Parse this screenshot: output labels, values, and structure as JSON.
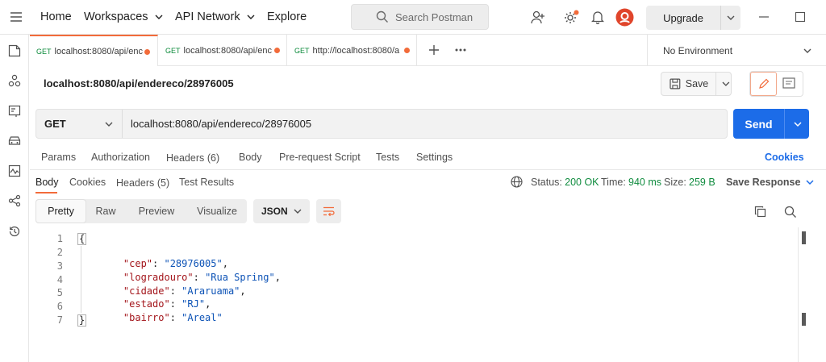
{
  "topbar": {
    "home": "Home",
    "workspaces": "Workspaces",
    "api_network": "API Network",
    "explore": "Explore",
    "search_placeholder": "Search Postman",
    "upgrade": "Upgrade"
  },
  "tabs": [
    {
      "method": "GET",
      "label": "localhost:8080/api/enc"
    },
    {
      "method": "GET",
      "label": "localhost:8080/api/enc"
    },
    {
      "method": "GET",
      "label": "http://localhost:8080/a"
    }
  ],
  "environment": "No Environment",
  "request": {
    "title": "localhost:8080/api/endereco/28976005",
    "save_label": "Save",
    "method": "GET",
    "url": "localhost:8080/api/endereco/28976005",
    "send_label": "Send"
  },
  "request_tabs": {
    "params": "Params",
    "authorization": "Authorization",
    "headers": "Headers",
    "headers_count": "(6)",
    "body": "Body",
    "prerequest": "Pre-request Script",
    "tests": "Tests",
    "settings": "Settings",
    "cookies": "Cookies"
  },
  "response_tabs": {
    "body": "Body",
    "cookies": "Cookies",
    "headers": "Headers",
    "headers_count": "(5)",
    "test_results": "Test Results"
  },
  "response_meta": {
    "status_label": "Status:",
    "status_value": "200 OK",
    "time_label": "Time:",
    "time_value": "940 ms",
    "size_label": "Size:",
    "size_value": "259 B",
    "save_response": "Save Response"
  },
  "view_modes": {
    "pretty": "Pretty",
    "raw": "Raw",
    "preview": "Preview",
    "visualize": "Visualize",
    "format": "JSON"
  },
  "response_body": {
    "line_numbers": [
      "1",
      "2",
      "3",
      "4",
      "5",
      "6",
      "7"
    ],
    "open_brace": "{",
    "close_brace": "}",
    "fields": [
      {
        "key": "\"cep\"",
        "value": "\"28976005\"",
        "comma": ","
      },
      {
        "key": "\"logradouro\"",
        "value": "\"Rua Spring\"",
        "comma": ","
      },
      {
        "key": "\"cidade\"",
        "value": "\"Araruama\"",
        "comma": ","
      },
      {
        "key": "\"estado\"",
        "value": "\"RJ\"",
        "comma": ","
      },
      {
        "key": "\"bairro\"",
        "value": "\"Areal\"",
        "comma": ""
      }
    ]
  },
  "colors": {
    "send_button": "#1c6ce8",
    "status_green": "#108c3f",
    "unsaved_dot": "#f26b3a",
    "json_key": "#a3151b",
    "json_string": "#0d53b6"
  }
}
